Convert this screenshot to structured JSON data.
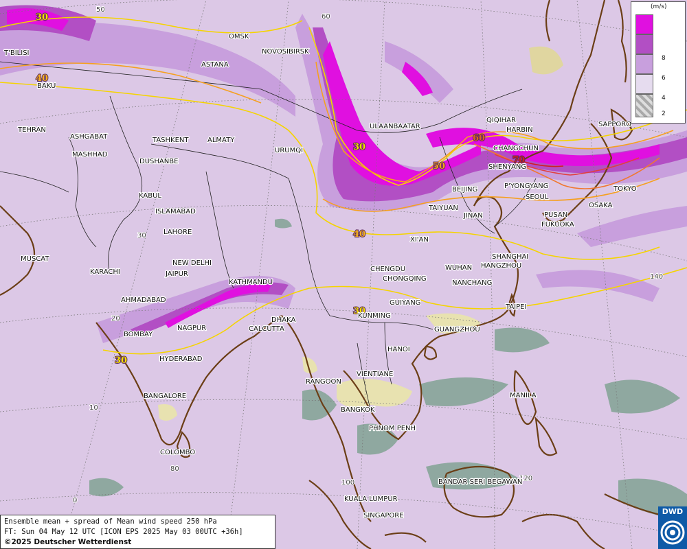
{
  "map": {
    "title_lines": [
      "Ensemble mean + spread of Mean wind speed 250 hPa",
      "FT: Sun 04 May 12 UTC [ICON EPS 2025 May 03 00UTC +36h]",
      "©2025 Deutscher Wetterdienst"
    ],
    "logo": "DWD",
    "legend": {
      "unit": "(m/s)",
      "ticks": [
        "8",
        "6",
        "4",
        "2"
      ],
      "colors": [
        "#e010e0",
        "#b24fc4",
        "#c89fdd",
        "#e6dcef",
        "#bbbbbb"
      ]
    },
    "grid_labels": [
      "50",
      "60",
      "30",
      "20",
      "10",
      "0",
      "80",
      "100",
      "120",
      "140"
    ],
    "contour_labels": [
      "30",
      "40",
      "30",
      "30",
      "30",
      "40",
      "50",
      "60",
      "70",
      "30"
    ],
    "cities": [
      "T'BILISI",
      "BAKU",
      "TEHRAN",
      "ASHGABAT",
      "MASHHAD",
      "OMSK",
      "NOVOSIBIRSK",
      "ASTANA",
      "TASHKENT",
      "ALMATY",
      "DUSHANBE",
      "URUMQI",
      "ULAANBAATAR",
      "QIQIHAR",
      "HARBIN",
      "CHANGCHUN",
      "SHENYANG",
      "SAPPORO",
      "P'YONGYANG",
      "SEOUL",
      "BEIJING",
      "TOKYO",
      "OSAKA",
      "PUSAN",
      "FUKUOKA",
      "TAIYUAN",
      "JINAN",
      "KABUL",
      "ISLAMABAD",
      "LAHORE",
      "XI'AN",
      "MUSCAT",
      "KARACHI",
      "NEW DELHI",
      "JAIPUR",
      "SHANGHAI",
      "HANGZHOU",
      "CHENGDU",
      "CHONGQING",
      "WUHAN",
      "NANCHANG",
      "KATHMANDU",
      "AHMADABAD",
      "GUIYANG",
      "TAIPEI",
      "DHAKA",
      "KUNMING",
      "BOMBAY",
      "NAGPUR",
      "CALCUTTA",
      "GUANGZHOU",
      "HANOI",
      "HYDERABAD",
      "RANGOON",
      "VIENTIANE",
      "BANGALORE",
      "BANGKOK",
      "MANILA",
      "PHNOM PENH",
      "COLOMBO",
      "BANDAR SERI BEGAWAN",
      "KUALA LUMPUR",
      "SINGAPORE"
    ]
  }
}
